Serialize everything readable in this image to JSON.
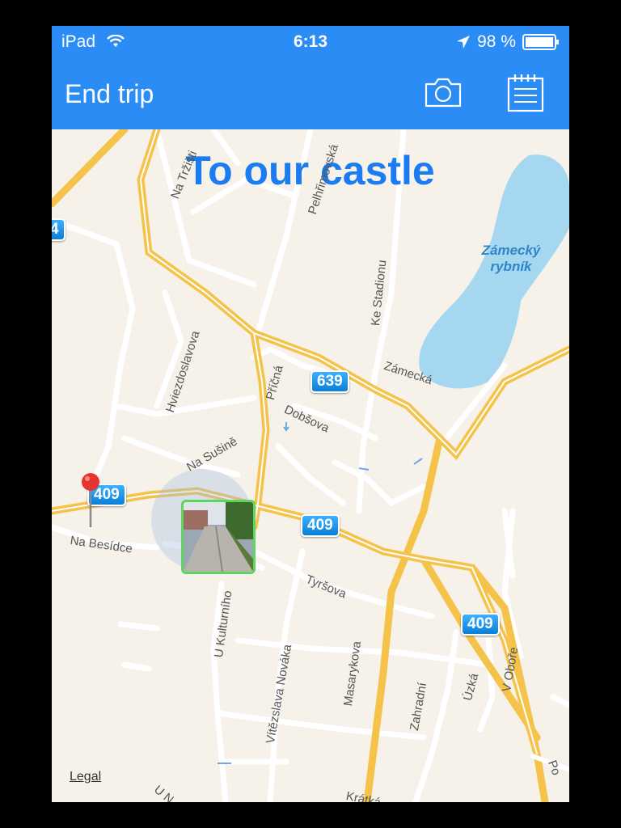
{
  "status": {
    "device": "iPad",
    "time": "6:13",
    "battery": "98 %",
    "icons": [
      "wifi-icon",
      "location-arrow-icon",
      "battery-icon"
    ]
  },
  "navbar": {
    "end_trip_label": "End trip",
    "camera_icon": "camera-icon",
    "notes_icon": "notepad-icon",
    "color": "#2b8cf5"
  },
  "trip": {
    "title": "To our castle"
  },
  "map": {
    "lake_name_line1": "Zámecký",
    "lake_name_line2": "rybník",
    "route_badges": [
      "4",
      "639",
      "409",
      "409",
      "409"
    ],
    "streets": [
      "Na Tržišti",
      "Pelhřimovská",
      "Ke Stadionu",
      "Hviezdoslavova",
      "Příčná",
      "Zámecká",
      "Dobšova",
      "Na Sušině",
      "Na Besídce",
      "Tyršova",
      "U Kulturního",
      "Vítězslava Nováka",
      "Masarykova",
      "Zahradní",
      "Úzká",
      "V Oboře",
      "Krátká",
      "U N",
      "Po"
    ],
    "legal": "Legal"
  }
}
